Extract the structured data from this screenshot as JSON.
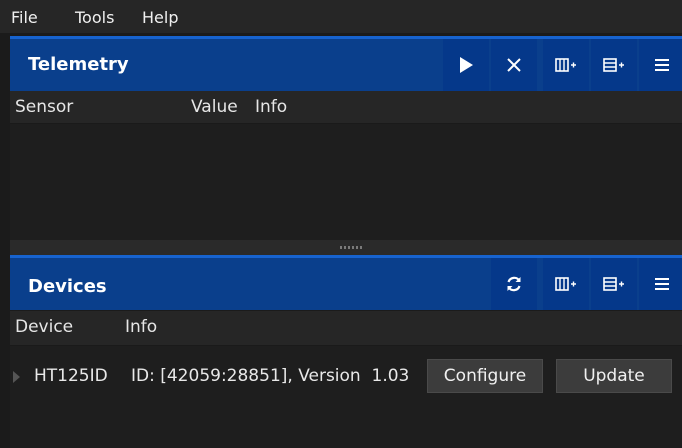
{
  "menu": {
    "file": "File",
    "tools": "Tools",
    "help": "Help"
  },
  "telemetry": {
    "title": "Telemetry",
    "columns": [
      "Sensor",
      "Value",
      "Info"
    ],
    "toolbar": [
      "play-icon",
      "close-icon",
      "add-column-icon",
      "add-row-icon",
      "menu-icon"
    ]
  },
  "devices": {
    "title": "Devices",
    "columns": [
      "Device",
      "Info"
    ],
    "toolbar": [
      "refresh-icon",
      "add-column-icon",
      "add-row-icon",
      "menu-icon"
    ],
    "rows": [
      {
        "device": "HT125ID",
        "info": "ID: [42059:28851], Version  1.03",
        "configure_label": "Configure",
        "update_label": "Update"
      }
    ]
  },
  "colors": {
    "header": "#0a3f8c",
    "accent": "#1763cf",
    "background": "#1b1b1b"
  }
}
